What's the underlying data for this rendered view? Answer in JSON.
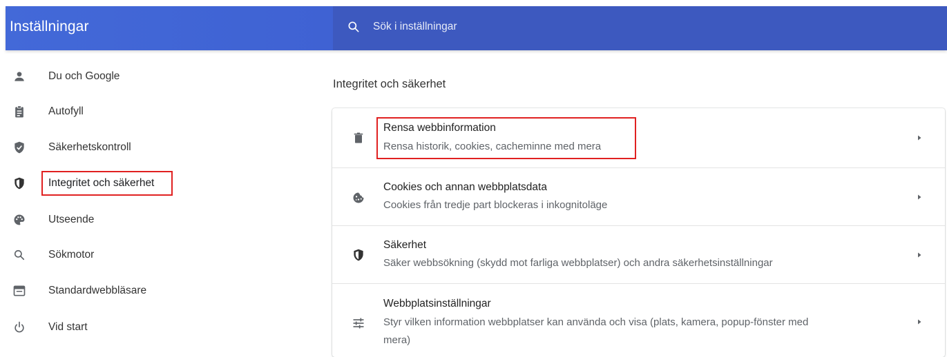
{
  "header": {
    "title": "Inställningar",
    "search_placeholder": "Sök i inställningar"
  },
  "sidebar": {
    "items": [
      {
        "label": "Du och Google",
        "icon": "person-icon"
      },
      {
        "label": "Autofyll",
        "icon": "clipboard-icon"
      },
      {
        "label": "Säkerhetskontroll",
        "icon": "shield-check-icon"
      },
      {
        "label": "Integritet och säkerhet",
        "icon": "shield-half-icon",
        "active": true
      },
      {
        "label": "Utseende",
        "icon": "palette-icon"
      },
      {
        "label": "Sökmotor",
        "icon": "search-icon"
      },
      {
        "label": "Standardwebbläsare",
        "icon": "browser-window-icon"
      },
      {
        "label": "Vid start",
        "icon": "power-icon"
      }
    ]
  },
  "main": {
    "section_title": "Integritet och säkerhet",
    "rows": [
      {
        "title": "Rensa webbinformation",
        "subtitle": "Rensa historik, cookies, cacheminne med mera",
        "icon": "trash-icon"
      },
      {
        "title": "Cookies och annan webbplatsdata",
        "subtitle": "Cookies från tredje part blockeras i inkognitoläge",
        "icon": "cookie-icon"
      },
      {
        "title": "Säkerhet",
        "subtitle": "Säker webbsökning (skydd mot farliga webbplatser) och andra säkerhetsinställningar",
        "icon": "shield-half-icon"
      },
      {
        "title": "Webbplatsinställningar",
        "subtitle_line1": "Styr vilken information webbplatser kan använda och visa (plats, kamera, popup-fönster med",
        "subtitle_line2": "mera)",
        "icon": "tune-icon"
      }
    ]
  },
  "colors": {
    "header_blue": "#4369d8",
    "search_blue": "#3d59bf",
    "highlight_red": "#e02020",
    "icon_gray": "#5f6368"
  }
}
